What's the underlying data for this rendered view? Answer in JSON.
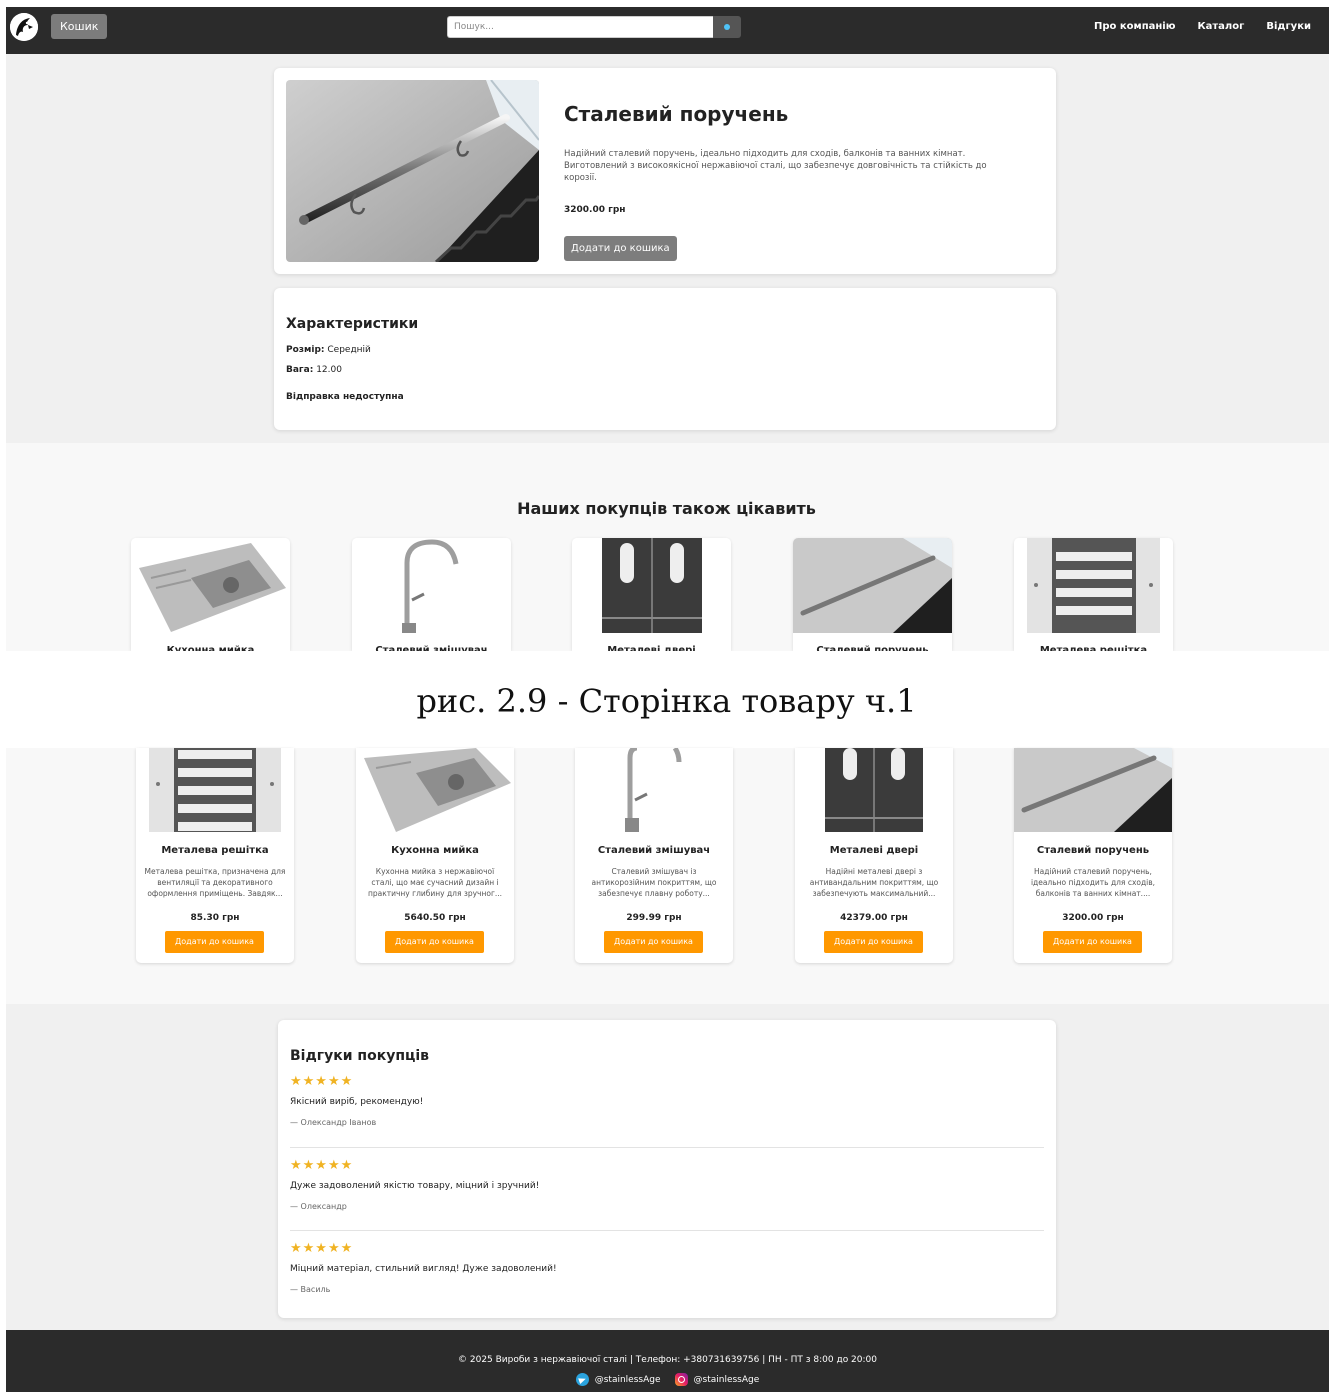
{
  "header": {
    "cart_label": "Кошик",
    "search_placeholder": "Пошук...",
    "nav": [
      "Про компанію",
      "Каталог",
      "Відгуки"
    ]
  },
  "product": {
    "title": "Сталевий поручень",
    "description": "Надійний сталевий поручень, ідеально підходить для сходів, балконів та ванних кімнат. Виготовлений з високоякісної нержавіючої сталі, що забезпечує довговічність та стійкість до корозії.",
    "price": "3200.00 грн",
    "add_to_cart": "Додати до кошика"
  },
  "specs": {
    "title": "Характеристики",
    "size_label": "Розмір:",
    "size_value": "Середній",
    "weight_label": "Вага:",
    "weight_value": "12.00",
    "shipping": "Відправка недоступна"
  },
  "also": {
    "title": "Наших покупців також цікавить"
  },
  "caption": "рис. 2.9 - Сторінка товару ч.1",
  "related": [
    {
      "name": "Металева решітка",
      "description": "Металева решітка, призначена для вентиляції та декоративного оформлення приміщень. Завдяк...",
      "price": "85.30 грн",
      "button": "Додати до кошика"
    },
    {
      "name": "Кухонна мийка",
      "description": "Кухонна мийка з нержавіючої сталі, що має сучасний дизайн і практичну глибину для зручног...",
      "price": "5640.50 грн",
      "button": "Додати до кошика"
    },
    {
      "name": "Сталевий змішувач",
      "description": "Сталевий змішувач із антикорозійним покриттям, що забезпечує плавну роботу...",
      "price": "299.99 грн",
      "button": "Додати до кошика"
    },
    {
      "name": "Металеві двері",
      "description": "Надійні металеві двері з антивандальним покриттям, що забезпечують максимальний...",
      "price": "42379.00 грн",
      "button": "Додати до кошика"
    },
    {
      "name": "Сталевий поручень",
      "description": "Надійний сталевий поручень, ідеально підходить для сходів, балконів та ванних кімнат....",
      "price": "3200.00 грн",
      "button": "Додати до кошика"
    }
  ],
  "reviews": {
    "title": "Відгуки покупців",
    "items": [
      {
        "stars": "★★★★★",
        "text": "Якісний виріб, рекомендую!",
        "author": "— Олександр Іванов"
      },
      {
        "stars": "★★★★★",
        "text": "Дуже задоволений якістю товару, міцний і зручний!",
        "author": "— Олександр"
      },
      {
        "stars": "★★★★★",
        "text": "Міцний матеріал, стильний вигляд! Дуже задоволений!",
        "author": "— Василь"
      }
    ]
  },
  "footer": {
    "text": "© 2025 Вироби з нержавіючої сталі | Телефон: +380731639756 | ПН - ПТ з 8:00 до 20:00",
    "telegram": "@stainlessAge",
    "instagram": "@stainlessAge"
  }
}
